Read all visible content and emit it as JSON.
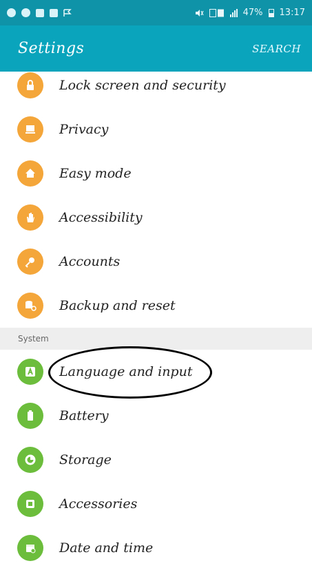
{
  "status": {
    "network": "47%",
    "time": "13:17",
    "left_icons": [
      "sync-icon",
      "whatsapp-icon",
      "gallery-icon",
      "calendar-icon",
      "flag-icon"
    ],
    "right_icons": [
      "mute-icon",
      "data-icon",
      "signal-icon",
      "battery-icon"
    ]
  },
  "header": {
    "title": "Settings",
    "search_label": "SEARCH"
  },
  "colors": {
    "statusbar": "#0f93a8",
    "appbar": "#0aa4bc",
    "orange": "#f4a63a",
    "green": "#6bbd3b",
    "section_bg": "#eeeeee"
  },
  "personal_items": [
    {
      "label": "Lock screen and security",
      "icon": "lock-icon"
    },
    {
      "label": "Privacy",
      "icon": "privacy-icon"
    },
    {
      "label": "Easy mode",
      "icon": "home-icon"
    },
    {
      "label": "Accessibility",
      "icon": "hand-icon"
    },
    {
      "label": "Accounts",
      "icon": "key-icon"
    },
    {
      "label": "Backup and reset",
      "icon": "backup-icon"
    }
  ],
  "system": {
    "header": "System",
    "items": [
      {
        "label": "Language and input",
        "icon": "language-icon"
      },
      {
        "label": "Battery",
        "icon": "battery-icon"
      },
      {
        "label": "Storage",
        "icon": "storage-icon"
      },
      {
        "label": "Accessories",
        "icon": "accessories-icon"
      },
      {
        "label": "Date and time",
        "icon": "calendar-icon"
      }
    ]
  }
}
